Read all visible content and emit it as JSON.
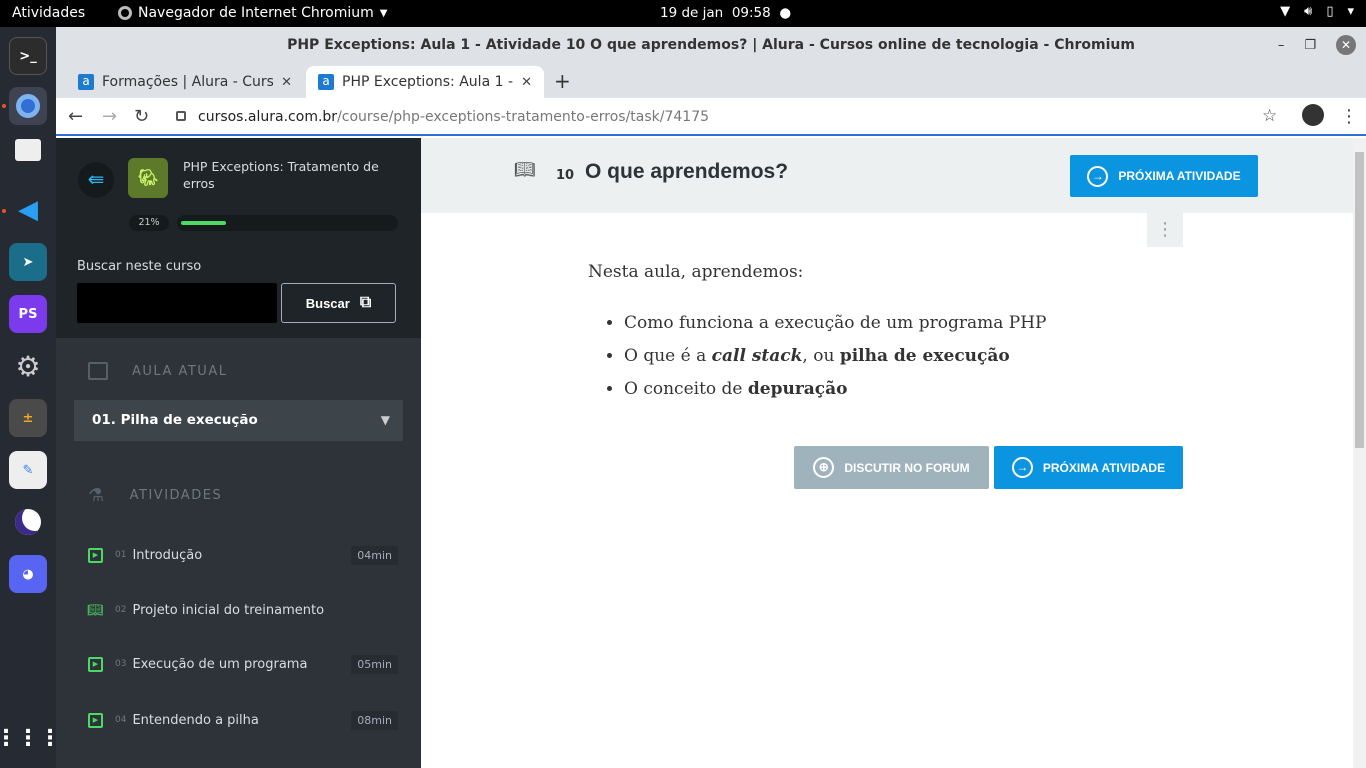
{
  "system": {
    "activities": "Atividades",
    "app_name": "Navegador de Internet Chromium",
    "date": "19 de jan",
    "time": "09:58"
  },
  "window": {
    "title": "PHP Exceptions: Aula 1 - Atividade 10 O que aprendemos? | Alura - Cursos online de tecnologia - Chromium"
  },
  "tabs": [
    {
      "label": "Formações | Alura - Cursos"
    },
    {
      "label": "PHP Exceptions: Aula 1 - Atividade"
    }
  ],
  "address": {
    "host": "cursos.alura.com.br",
    "path": "/course/php-exceptions-tratamento-erros/task/74175"
  },
  "sidebar": {
    "course_title": "PHP Exceptions: Tratamento de erros",
    "progress_label": "21%",
    "progress": 0.21,
    "search_label": "Buscar neste curso",
    "search_button": "Buscar",
    "section_current": "AULA ATUAL",
    "current_lesson": "01. Pilha de execução",
    "section_activities": "ATIVIDADES",
    "activities": [
      {
        "num": "01",
        "title": "Introdução",
        "duration": "04min",
        "icon": "video-icon"
      },
      {
        "num": "02",
        "title": "Projeto inicial do treinamento",
        "duration": "",
        "icon": "book-icon"
      },
      {
        "num": "03",
        "title": "Execução de um programa",
        "duration": "05min",
        "icon": "video-icon"
      },
      {
        "num": "04",
        "title": "Entendendo a pilha",
        "duration": "08min",
        "icon": "video-icon"
      }
    ]
  },
  "main": {
    "number": "10",
    "title": "O que aprendemos?",
    "next_button": "PRÓXIMA ATIVIDADE",
    "forum_button": "DISCUTIR NO FORUM",
    "intro": "Nesta aula, aprendemos:",
    "bullets": [
      {
        "pre": "Como funciona a execução de um programa PHP",
        "em": "",
        "mid": "",
        "strong": ""
      },
      {
        "pre": "O que é a ",
        "em": "call stack",
        "mid": ", ou ",
        "strong": "pilha de execução"
      },
      {
        "pre": "O conceito de ",
        "em": "",
        "mid": "",
        "strong": "depuração"
      }
    ]
  },
  "colors": {
    "accent": "#0b94e0",
    "progress": "#4cd964",
    "sidebar": "#2d3338"
  }
}
